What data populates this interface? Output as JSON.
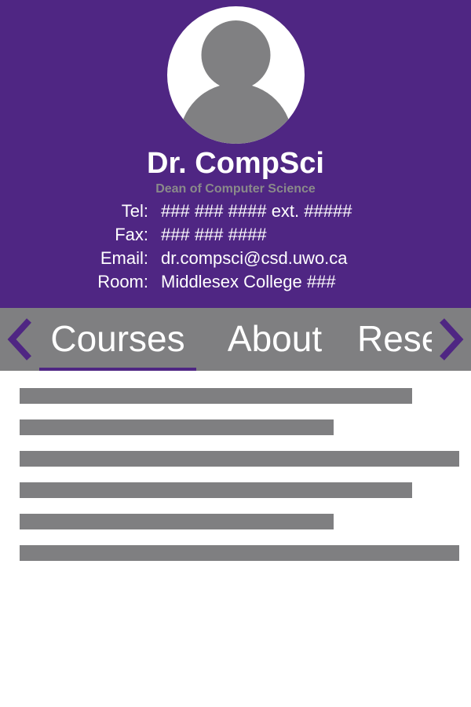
{
  "profile": {
    "name": "Dr. CompSci",
    "title": "Dean of Computer Science"
  },
  "contact": [
    {
      "label": "Tel:",
      "value": "### ### #### ext. #####"
    },
    {
      "label": "Fax:",
      "value": "### ### ####"
    },
    {
      "label": "Email:",
      "value": "dr.compsci@csd.uwo.ca"
    },
    {
      "label": "Room:",
      "value": "Middlesex College ###"
    }
  ],
  "tabs": [
    {
      "label": "Courses",
      "selected": true
    },
    {
      "label": "About",
      "selected": false
    },
    {
      "label": "Research",
      "selected": false
    }
  ],
  "nav": {
    "prev_icon": "chevron-left-icon",
    "next_icon": "chevron-right-icon"
  },
  "colors": {
    "brand_purple": "#4f2683",
    "gray": "#7f7f81",
    "subtitle_gray": "#8a8a8a",
    "white": "#ffffff"
  }
}
